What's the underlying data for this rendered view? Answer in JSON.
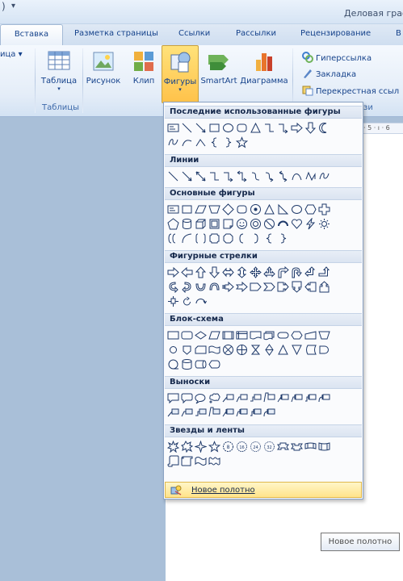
{
  "titlebar": {
    "title": "Деловая граф"
  },
  "tabs": [
    {
      "label": "Вставка"
    },
    {
      "label": "Разметка страницы"
    },
    {
      "label": "Ссылки"
    },
    {
      "label": "Рассылки"
    },
    {
      "label": "Рецензирование"
    },
    {
      "label": "В"
    }
  ],
  "ribbon": {
    "partial_label": "ица",
    "table_label": "Таблица",
    "tables_group": "Таблицы",
    "picture_label": "Рисунок",
    "clip_label": "Клип",
    "shapes_label": "Фигуры",
    "smartart_label": "SmartArt",
    "chart_label": "Диаграмма",
    "hyperlink_label": "Гиперссылка",
    "bookmark_label": "Закладка",
    "crossref_label": "Перекрестная ссыл",
    "links_group_partial": "зи"
  },
  "ruler": {
    "text": "· 5 · ı · 6"
  },
  "shapes_panel": {
    "sections": [
      {
        "title": "Последние использованные фигуры"
      },
      {
        "title": "Линии"
      },
      {
        "title": "Основные фигуры"
      },
      {
        "title": "Фигурные стрелки"
      },
      {
        "title": "Блок-схема"
      },
      {
        "title": "Выноски"
      },
      {
        "title": "Звезды и ленты"
      }
    ],
    "new_canvas_label": "Новое полотно"
  },
  "tooltip": {
    "text": "Новое полотно"
  },
  "colors": {
    "accent": "#15428b",
    "hover": "#ffd86b",
    "panel_bg": "#fafbfd"
  }
}
